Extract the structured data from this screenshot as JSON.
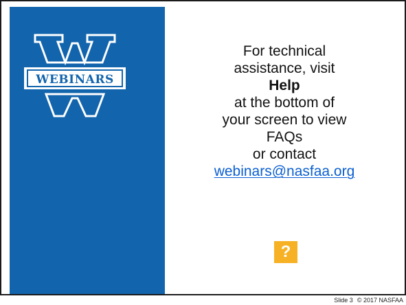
{
  "logo": {
    "text": "WEBINARS",
    "icon": "webinars-w-logo",
    "colors": {
      "panel": "#1264ad",
      "outline": "#ffffff"
    }
  },
  "message": {
    "line1": "For technical",
    "line2": "assistance, visit",
    "line3": "Help",
    "line4": "at the bottom of",
    "line5": "your screen to view",
    "line6": "FAQs",
    "line7": "or contact",
    "email": "webinars@nasfaa.org"
  },
  "help_button": {
    "label": "?",
    "color": "#f7b125"
  },
  "footer": {
    "slide_label": "Slide 3",
    "copyright": "© 2017 NASFAA"
  }
}
